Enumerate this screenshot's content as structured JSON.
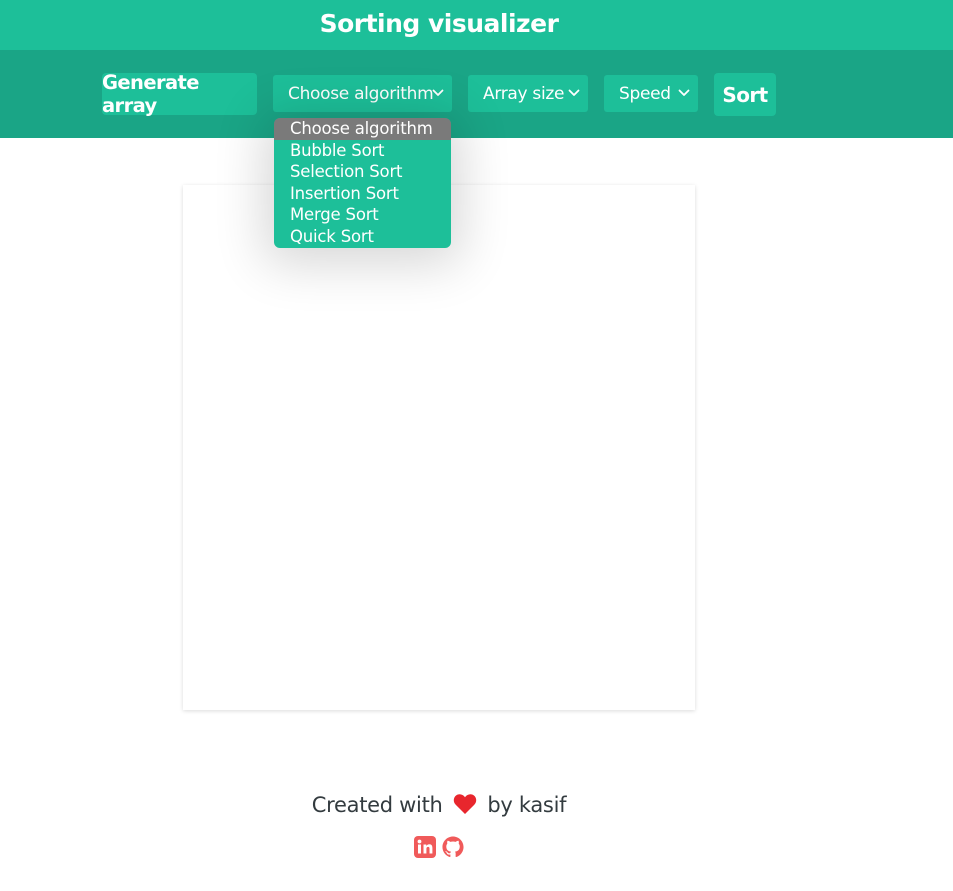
{
  "header": {
    "title": "Sorting visualizer"
  },
  "toolbar": {
    "generate_label": "Generate array",
    "algorithm_select": "Choose algorithm",
    "size_select": "Array size",
    "speed_select": "Speed",
    "sort_label": "Sort"
  },
  "dropdown": {
    "options": [
      "Choose algorithm",
      "Bubble Sort",
      "Selection Sort",
      "Insertion Sort",
      "Merge Sort",
      "Quick Sort"
    ],
    "selected_index": 0
  },
  "footer": {
    "before": "Created with",
    "after": "by kasif",
    "icons": [
      "heart-icon",
      "linkedin-icon",
      "github-icon"
    ]
  },
  "colors": {
    "primary": "#1dbf99",
    "toolbar": "#1aa586",
    "selected_option": "#7a7a7a",
    "heart": "#e8262d",
    "social": "#f05a5a"
  }
}
